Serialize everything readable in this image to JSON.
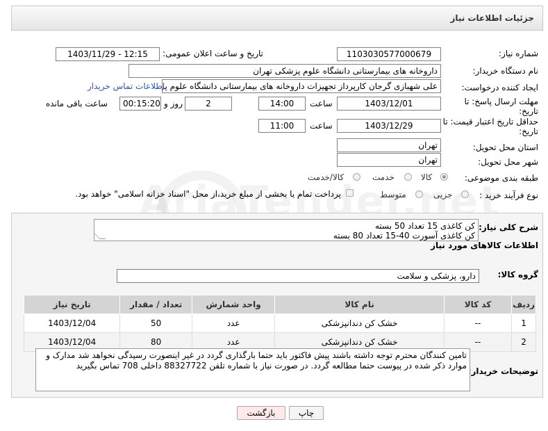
{
  "header": {
    "title": "جزئیات اطلاعات نیاز"
  },
  "fields": {
    "need_number_label": "شماره نیاز:",
    "need_number": "1103030577000679",
    "announce_label": "تاریخ و ساعت اعلان عمومی:",
    "announce_value": "1403/11/29 - 12:15",
    "buyer_org_label": "نام دستگاه خریدار:",
    "buyer_org": "داروخانه های بیمارستانی دانشگاه علوم پزشکی تهران",
    "requester_label": "ایجاد کننده درخواست:",
    "requester": "علی شهبازی گرجان کارپرداز تجهیزات داروخانه های بیمارستانی دانشگاه علوم پزشکی تهران",
    "contact_link": "اطلاعات تماس خریدار",
    "deadline_label_1": "مهلت ارسال پاسخ: تا",
    "deadline_label_2": "تاریخ:",
    "deadline_date": "1403/12/01",
    "time_label": "ساعت",
    "deadline_time": "14:00",
    "days_count": "2",
    "days_label": "روز و",
    "remaining_time": "00:15:20",
    "remaining_label": "ساعت باقی مانده",
    "price_validity_label_1": "حداقل تاریخ اعتبار قیمت: تا",
    "price_validity_label_2": "تاریخ:",
    "price_validity_date": "1403/12/29",
    "price_validity_time_label": "ساعت",
    "price_validity_time": "11:00",
    "province_label": "استان محل تحویل:",
    "province": "تهران",
    "city_label": "شهر محل تحویل:",
    "city": "تهران",
    "category_label": "طبقه بندی موضوعی:",
    "category_options": [
      "کالا",
      "خدمت",
      "کالا/خدمت"
    ],
    "category_selected": "کالا",
    "process_label": "نوع فرآیند خرید :",
    "process_options": [
      "جزیی",
      "متوسط"
    ],
    "payment_note": "پرداخت تمام یا بخشی از مبلغ خرید،از محل \"اسناد خزانه اسلامی\" خواهد بود."
  },
  "description": {
    "label": "شرح کلی نیاز:",
    "lines": [
      "کن کاغذی 15 تعداد 50 بسته",
      "کن کاغذی آسورت 40-15 تعداد 80 بسته"
    ]
  },
  "goods_info": {
    "title": "اطلاعات کالاهای مورد نیاز",
    "group_label": "گروه کالا:",
    "group_value": "دارو، پزشکی و سلامت"
  },
  "table": {
    "headers": [
      "ردیف",
      "کد کالا",
      "نام کالا",
      "واحد شمارش",
      "تعداد / مقدار",
      "تاریخ نیاز"
    ],
    "rows": [
      [
        "1",
        "--",
        "خشک کن دندانپزشکی",
        "عدد",
        "50",
        "1403/12/04"
      ],
      [
        "2",
        "--",
        "خشک کن دندانپزشکی",
        "عدد",
        "80",
        "1403/12/04"
      ]
    ]
  },
  "buyer_notes": {
    "label": "توضیحات خریدار:",
    "text": "تامین کنندگان محترم توجه داشته باشند پیش فاکتور باید حتما بارگذاری گردد در غیر اینصورت رسیدگی نخواهد شد مدارک و موارد ذکر شده در پیوست حتما مطالعه گردد. در صورت نیاز با شماره تلفن 88327722 داخلی 708 تماس بگیرید"
  },
  "buttons": {
    "print": "چاپ",
    "back": "بازگشت"
  },
  "watermark": "AriaTender.net",
  "colors": {
    "link": "#2d57a8",
    "back_button_bg": "#fde9ea"
  }
}
